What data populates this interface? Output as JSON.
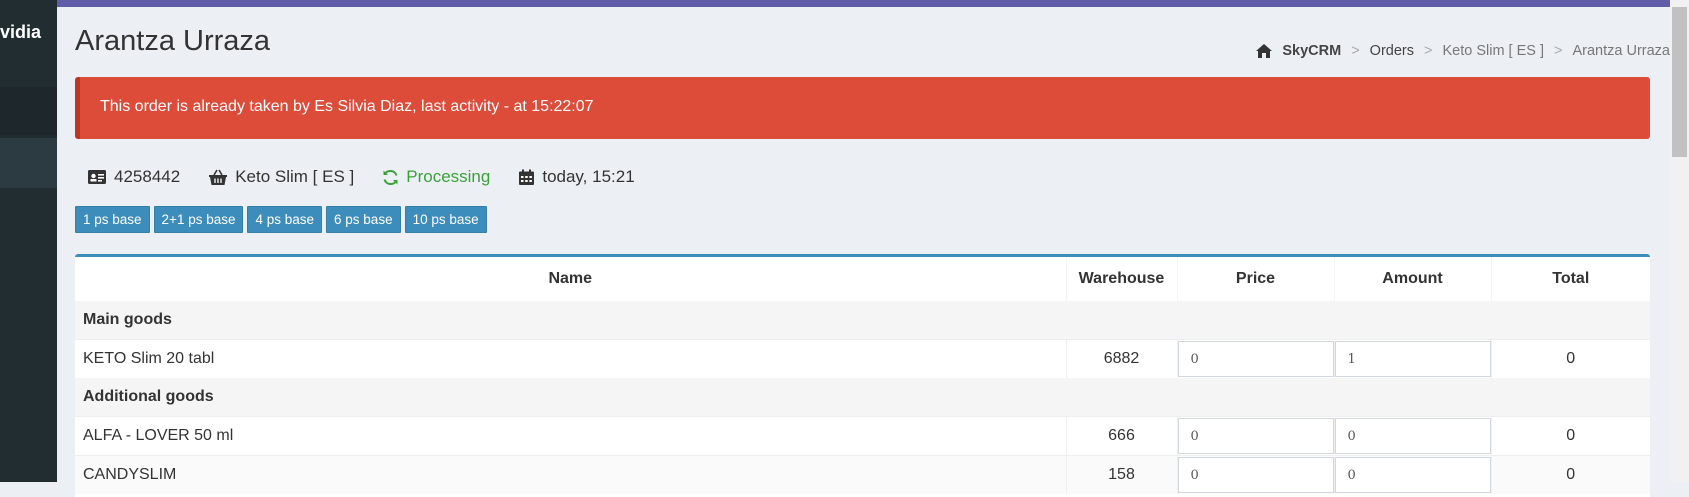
{
  "sidebar": {
    "brand_text": "vidia"
  },
  "page": {
    "title": "Arantza Urraza"
  },
  "breadcrumb": {
    "home_label": "SkyCRM",
    "items": [
      "Orders",
      "Keto Slim [ ES ]",
      "Arantza Urraza"
    ]
  },
  "alert": {
    "text": "This order is already taken by Es Silvia Diaz, last activity - at 15:22:07",
    "color": "#dd4b39"
  },
  "order_info": {
    "id": "4258442",
    "product": "Keto Slim [ ES ]",
    "status": "Processing",
    "date": "today, 15:21",
    "status_color": "#3c9f3c"
  },
  "presets": [
    "1 ps base",
    "2+1 ps base",
    "4 ps base",
    "6 ps base",
    "10 ps base"
  ],
  "table": {
    "headers": [
      "Name",
      "Warehouse",
      "Price",
      "Amount",
      "Total"
    ],
    "groups": [
      {
        "label": "Main goods"
      },
      {
        "label": "Additional goods"
      }
    ],
    "rows": [
      {
        "name": "KETO Slim 20 tabl",
        "warehouse": "6882",
        "price": "0",
        "amount": "1",
        "total": "0"
      },
      {
        "name": "ALFA - LOVER 50 ml",
        "warehouse": "666",
        "price": "0",
        "amount": "0",
        "total": "0"
      },
      {
        "name": "CANDYSLIM",
        "warehouse": "158",
        "price": "0",
        "amount": "0",
        "total": "0"
      }
    ]
  },
  "icons": {
    "home": "home-icon",
    "id_card": "id-card-icon",
    "basket": "basket-icon",
    "refresh": "refresh-icon",
    "calendar": "calendar-icon"
  }
}
